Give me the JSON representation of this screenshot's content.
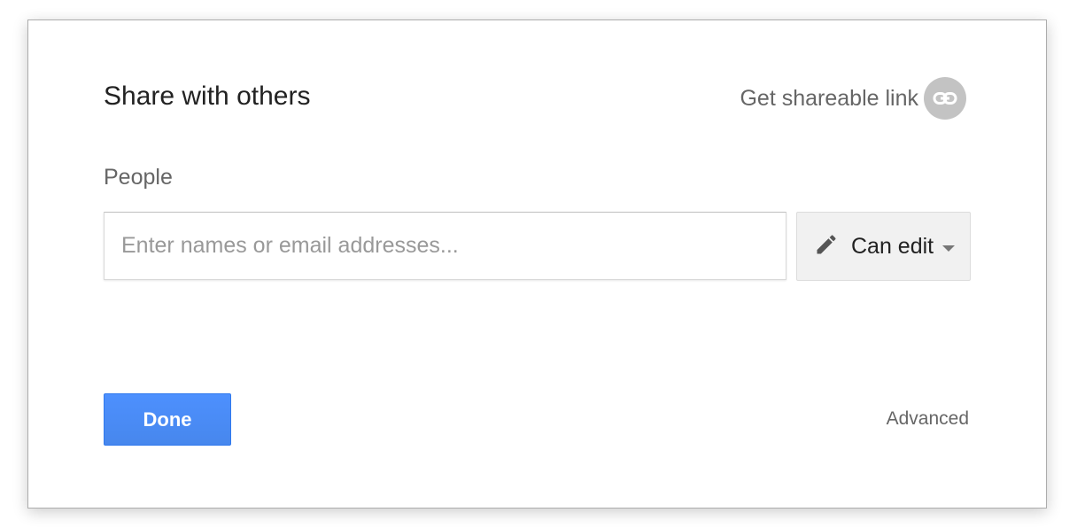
{
  "dialog": {
    "title": "Share with others",
    "share_link": {
      "label": "Get shareable link",
      "icon": "link-icon"
    },
    "people": {
      "label": "People",
      "input_value": "",
      "input_placeholder": "Enter names or email addresses..."
    },
    "permission": {
      "icon": "pencil-icon",
      "selected": "Can edit"
    },
    "done_label": "Done",
    "advanced_label": "Advanced"
  },
  "colors": {
    "primary_button": "#4d90fe",
    "link_icon_bg": "#c3c3c3",
    "muted_text": "#666666"
  }
}
